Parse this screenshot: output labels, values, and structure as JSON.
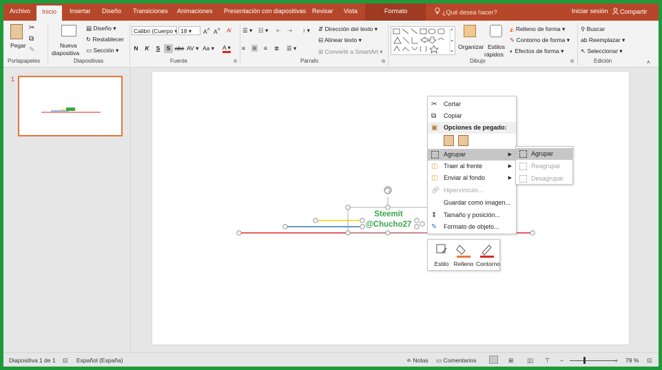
{
  "tabs": {
    "archivo": "Archivo",
    "inicio": "Inicio",
    "insertar": "Insertar",
    "diseno": "Diseño",
    "transiciones": "Transiciones",
    "animaciones": "Animaciones",
    "presentacion": "Presentación con diapositivas",
    "revisar": "Revisar",
    "vista": "Vista",
    "formato": "Formato",
    "search": "¿Qué desea hacer?",
    "signin": "Iniciar sesión",
    "share": "Compartir"
  },
  "ribbon": {
    "portapapeles": {
      "label": "Portapapeles",
      "pegar": "Pegar"
    },
    "diapositivas": {
      "label": "Diapositivas",
      "nueva_line1": "Nueva",
      "nueva_line2": "diapositiva",
      "diseno": "Diseño",
      "restablecer": "Restablecer",
      "seccion": "Sección"
    },
    "fuente": {
      "label": "Fuente",
      "font_name": "Calibri (Cuerpo",
      "font_size": "18",
      "bold": "N",
      "italic": "K",
      "underline": "S",
      "shadow": "S",
      "strike": "abc",
      "spacing": "AV",
      "case": "Aa"
    },
    "parrafo": {
      "label": "Párrafo",
      "direccion": "Dirección del texto",
      "alinear": "Alinear texto",
      "convertir": "Convertir a SmartArt"
    },
    "dibujo": {
      "label": "Dibujo",
      "organizar": "Organizar",
      "estilos_line1": "Estilos",
      "estilos_line2": "rápidos",
      "relleno": "Relleno de forma",
      "contorno": "Contorno de forma",
      "efectos": "Efectos de forma"
    },
    "edicion": {
      "label": "Edición",
      "buscar": "Buscar",
      "reemplazar": "Reemplazar",
      "seleccionar": "Seleccionar"
    }
  },
  "thumbnail": {
    "number": "1"
  },
  "slide": {
    "text_line1": "Steemit",
    "text_line2": "@Chucho27"
  },
  "context_menu": {
    "cortar": "Cortar",
    "copiar": "Copiar",
    "opciones_pegado": "Opciones de pegado:",
    "agrupar": "Agrupar",
    "traer": "Traer al frente",
    "enviar": "Enviar al fondo",
    "hipervinculo": "Hipervínculo...",
    "guardar": "Guardar como imagen...",
    "tamano": "Tamaño y posición...",
    "formato_objeto": "Formato de objeto..."
  },
  "submenu": {
    "agrupar": "Agrupar",
    "reagrupar": "Reagrupar",
    "desagrupar": "Desagrupar"
  },
  "mini_toolbar": {
    "estilo": "Estilo",
    "relleno": "Relleno",
    "contorno": "Contorno"
  },
  "status": {
    "slide_info": "Diapositiva 1 de 1",
    "language": "Español (España)",
    "notas": "Notas",
    "comentarios": "Comentarios",
    "zoom": "79 %",
    "zoom_minus": "−",
    "zoom_plus": "+"
  },
  "colors": {
    "brand": "#b7472a",
    "frame": "#1f9a3a",
    "line_red": "#e02424",
    "line_blue": "#2e75b6",
    "line_yellow": "#f2d600",
    "text_green": "#3aa64a"
  }
}
